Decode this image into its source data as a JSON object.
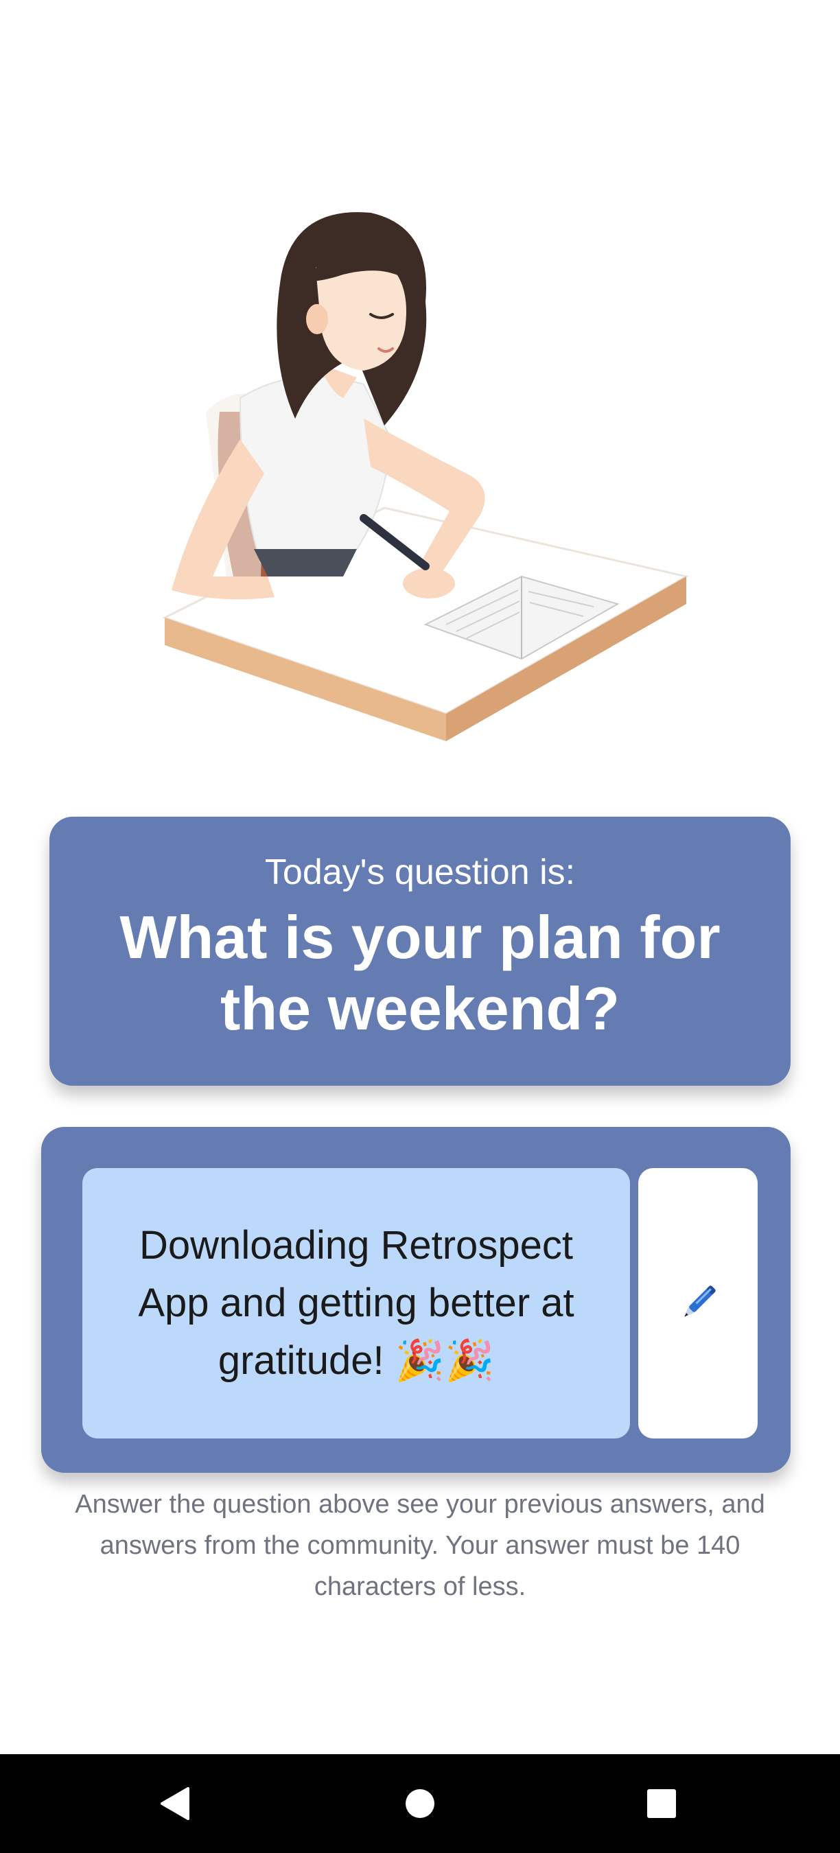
{
  "illustration": {
    "icon": "woman-writing-in-notebook-illustration"
  },
  "question_card": {
    "label": "Today's question is:",
    "question": "What is your plan for the weekend?",
    "background": "#647cb1"
  },
  "answer_card": {
    "answer": "Downloading Retrospect App and getting better at gratitude! 🎉🎉",
    "answer_background": "#bcd9fb",
    "edit_icon": "pen-icon"
  },
  "helper_text": "Answer the question above see your previous answers, and answers from the community. Your answer must be 140 characters of less.",
  "nav_bar": {
    "back_icon": "back-triangle-icon",
    "home_icon": "home-circle-icon",
    "recents_icon": "recents-square-icon"
  }
}
